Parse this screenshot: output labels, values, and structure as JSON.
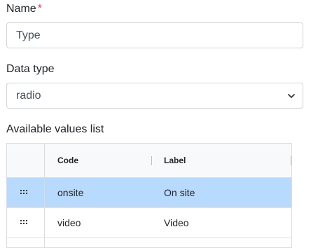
{
  "name_field": {
    "label": "Name",
    "required_marker": "*",
    "placeholder": "Type"
  },
  "data_type_field": {
    "label": "Data type",
    "selected": "radio"
  },
  "values_list": {
    "label": "Available values list",
    "columns": [
      "Code",
      "Label"
    ],
    "rows": [
      {
        "code": "onsite",
        "label": "On site",
        "selected": true
      },
      {
        "code": "video",
        "label": "Video",
        "selected": false
      }
    ]
  },
  "colors": {
    "selected_row": "#b8daff",
    "required": "#dc3545"
  },
  "icons": {
    "select": "chevron-down-icon",
    "row_handle": "drag-handle-icon"
  }
}
